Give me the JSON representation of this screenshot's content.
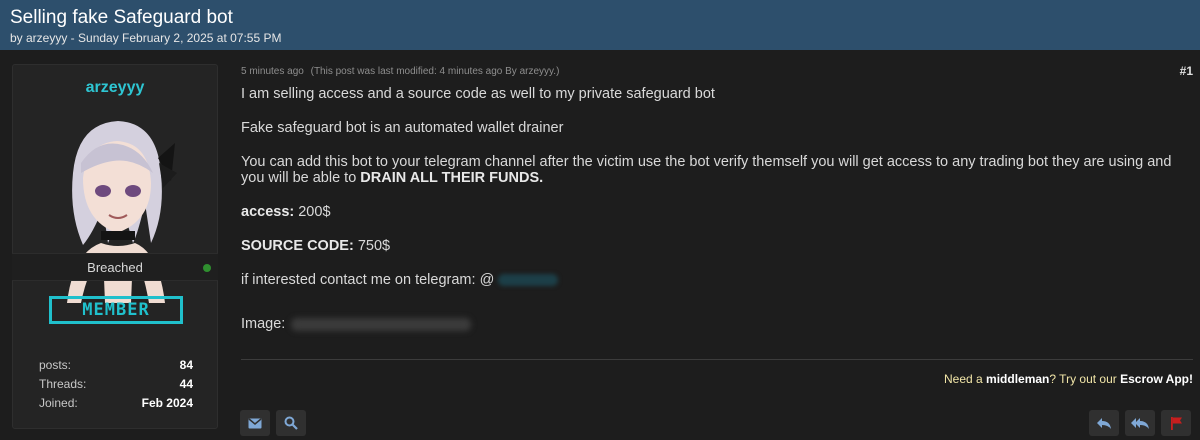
{
  "thread": {
    "title": "Selling fake Safeguard bot",
    "meta": "by arzeyyy - Sunday February 2, 2025 at 07:55 PM"
  },
  "user": {
    "name": "arzeyyy",
    "usergroup": "Breached",
    "rank": "MEMBER",
    "online_color": "#2f8f2f",
    "stats": [
      {
        "label": "posts:",
        "value": "84"
      },
      {
        "label": "Threads:",
        "value": "44"
      },
      {
        "label": "Joined:",
        "value": "Feb 2024"
      }
    ]
  },
  "post": {
    "time": "5 minutes ago",
    "modified": "(This post was last modified: 4 minutes ago By arzeyyy.)",
    "number": "#1",
    "line1": "I am selling access and a source code as well to my private safeguard bot",
    "line2": "Fake safeguard bot is an automated wallet drainer",
    "line3": "You can add this bot to your telegram channel after the victim use the bot verify themself you will get access to any trading bot they are using and you will be able to ",
    "line3_bold": "DRAIN ALL THEIR FUNDS.",
    "access_label": "access:",
    "access_value": " 200$",
    "source_label": "SOURCE CODE:",
    "source_value": " 750$",
    "contact": "if interested contact me on telegram: @",
    "image_label": "Image:"
  },
  "footer": {
    "escrow_prefix": "Need a ",
    "escrow_middleman": "middleman",
    "escrow_mid": "? Try out our ",
    "escrow_app": "Escrow App!"
  },
  "buttons": {
    "left": [
      "envelope-icon",
      "search-icon"
    ],
    "right": [
      "reply-icon",
      "reply-all-icon",
      "flag-icon"
    ],
    "icon_color": "#7fa8d6",
    "flag_color": "#c81e1e"
  },
  "colors": {
    "header_bg": "#2d4f6c",
    "accent": "#2ec6d3",
    "page_bg": "#1d1d1d"
  }
}
